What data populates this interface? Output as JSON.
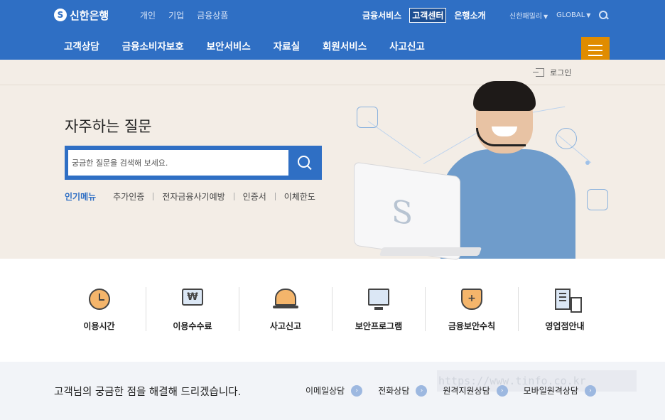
{
  "brand": {
    "logo_text": "신한은행"
  },
  "top_nav": [
    "개인",
    "기업",
    "금융상품"
  ],
  "center_links": [
    {
      "label": "금융서비스",
      "active": false
    },
    {
      "label": "고객센터",
      "active": true
    },
    {
      "label": "은행소개",
      "active": false
    }
  ],
  "util": {
    "family": "신한패밀리",
    "global": "GLOBAL",
    "search_icon": "search-icon"
  },
  "main_nav": [
    "고객상담",
    "금융소비자보호",
    "보안서비스",
    "자료실",
    "회원서비스",
    "사고신고"
  ],
  "menu_icon": "hamburger-icon",
  "colors": {
    "brand_blue": "#2f6fc4",
    "menu_orange": "#e08c00",
    "hero_bg": "#f3ede6"
  },
  "hero": {
    "login": "로그인",
    "faq_title": "자주하는 질문",
    "search_placeholder": "궁금한 질문을 검색해 보세요.",
    "popular_label": "인기메뉴",
    "popular_keywords": [
      "추가인증",
      "전자금융사기예방",
      "인증서",
      "이체한도"
    ]
  },
  "quick_menu": [
    {
      "label": "이용시간",
      "icon": "clock-icon"
    },
    {
      "label": "이용수수료",
      "icon": "won-monitor-icon"
    },
    {
      "label": "사고신고",
      "icon": "siren-icon"
    },
    {
      "label": "보안프로그램",
      "icon": "security-monitor-icon"
    },
    {
      "label": "금융보안수칙",
      "icon": "shield-icon"
    },
    {
      "label": "영업점안내",
      "icon": "building-icon"
    }
  ],
  "contact": {
    "title": "고객님의 궁금한 점을 해결해 드리겠습니다.",
    "links": [
      "이메일상담",
      "전화상담",
      "원격지원상담",
      "모바일원격상담"
    ],
    "watermark": "https://www.tinfo.co.kr"
  }
}
